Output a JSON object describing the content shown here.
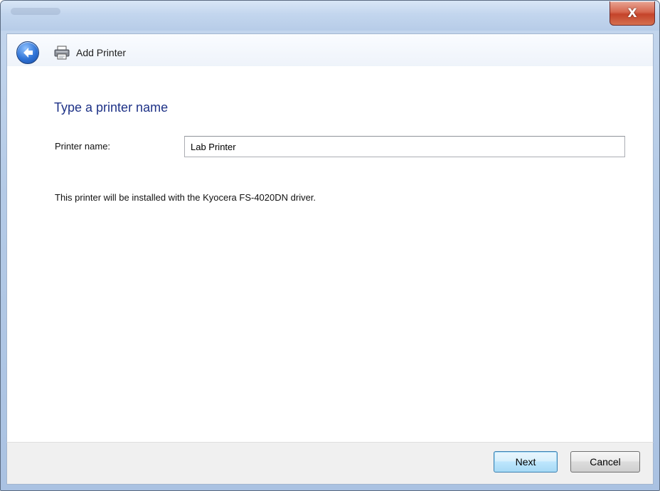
{
  "window": {
    "close_label": "X"
  },
  "navbar": {
    "title": "Add Printer"
  },
  "page": {
    "heading": "Type a printer name",
    "name_label": "Printer name:",
    "name_value": "Lab Printer",
    "info_text": "This printer will be installed with the Kyocera FS-4020DN driver."
  },
  "footer": {
    "next_label": "Next",
    "cancel_label": "Cancel"
  },
  "icons": {
    "back": "back-arrow-icon",
    "printer": "printer-icon",
    "close": "close-icon"
  },
  "colors": {
    "heading": "#1e3287",
    "accent_button": "#3c7fb1",
    "close_button": "#c4432a"
  }
}
